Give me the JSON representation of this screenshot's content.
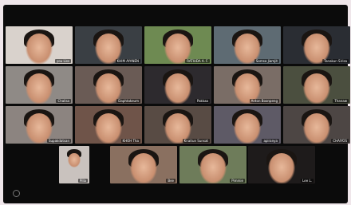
{
  "gallery": {
    "rows": [
      [
        {
          "name": "you Liss",
          "bg": "#d9d2cc"
        },
        {
          "name": "KHIM AYANEN",
          "bg": "#3a3f44"
        },
        {
          "name": "RATIUDA A. F.",
          "bg": "#6e8a52"
        },
        {
          "name": "Somsa Jiamjit",
          "bg": "#5e6b73"
        },
        {
          "name": "Tanakun Sirisa",
          "bg": "#2a2d33"
        }
      ],
      [
        {
          "name": "Chalisa",
          "bg": "#8f8a86"
        },
        {
          "name": "Daphtakeum",
          "bg": "#6a5b55"
        },
        {
          "name": "Pakkaa",
          "bg": "#2d2a2e"
        },
        {
          "name": "Anton Boonpeng",
          "bg": "#7a6d66"
        },
        {
          "name": "Thanaw",
          "bg": "#4b4f3f"
        }
      ],
      [
        {
          "name": "Supakdatsan",
          "bg": "#8c8480"
        },
        {
          "name": "KHOH Tha",
          "bg": "#6f5449"
        },
        {
          "name": "Knaitun Sunsat",
          "bg": "#584b44"
        },
        {
          "name": "apiranya",
          "bg": "#5e5a66"
        },
        {
          "name": "CHAIYOS",
          "bg": "#4d4644"
        }
      ],
      [
        {
          "name": "Pilla",
          "bg": "#c9c2be"
        },
        {
          "name": "Bee",
          "bg": "#8a7060"
        },
        {
          "name": "Pimmie",
          "bg": "#6e7c5a"
        },
        {
          "name": "Lee L.",
          "bg": "#1e1b1b"
        }
      ]
    ]
  }
}
